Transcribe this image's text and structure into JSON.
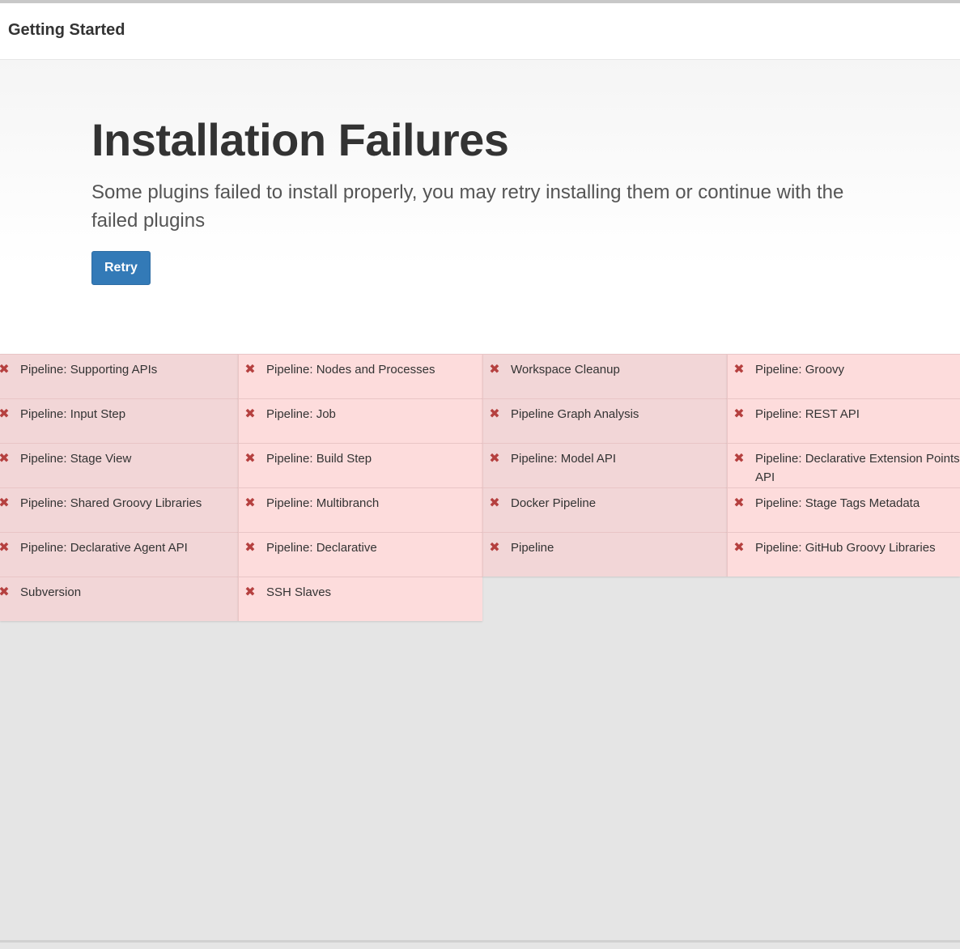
{
  "header": {
    "title": "Getting Started"
  },
  "hero": {
    "title": "Installation Failures",
    "description": "Some plugins failed to install properly, you may retry installing them or continue with the failed plugins",
    "retry_label": "Retry"
  },
  "icons": {
    "failed": "close-icon",
    "failed_color": "#b5403f"
  },
  "plugins": {
    "col1": [
      "Pipeline: Supporting APIs",
      "Pipeline: Input Step",
      "Pipeline: Stage View",
      "Pipeline: Shared Groovy Libraries",
      "Pipeline: Declarative Agent API",
      "Subversion"
    ],
    "col2": [
      "Pipeline: Nodes and Processes",
      "Pipeline: Job",
      "Pipeline: Build Step",
      "Pipeline: Multibranch",
      "Pipeline: Declarative",
      "SSH Slaves"
    ],
    "col3": [
      "Workspace Cleanup",
      "Pipeline Graph Analysis",
      "Pipeline: Model API",
      "Docker Pipeline",
      "Pipeline"
    ],
    "col4": [
      "Pipeline: Groovy",
      "Pipeline: REST API",
      "Pipeline: Declarative Extension Points API",
      "Pipeline: Stage Tags Metadata",
      "Pipeline: GitHub Groovy Libraries"
    ]
  },
  "colors": {
    "failed_bg_dark": "#f2d6d7",
    "failed_bg_light": "#fddcdc",
    "button": "#337ab7"
  }
}
